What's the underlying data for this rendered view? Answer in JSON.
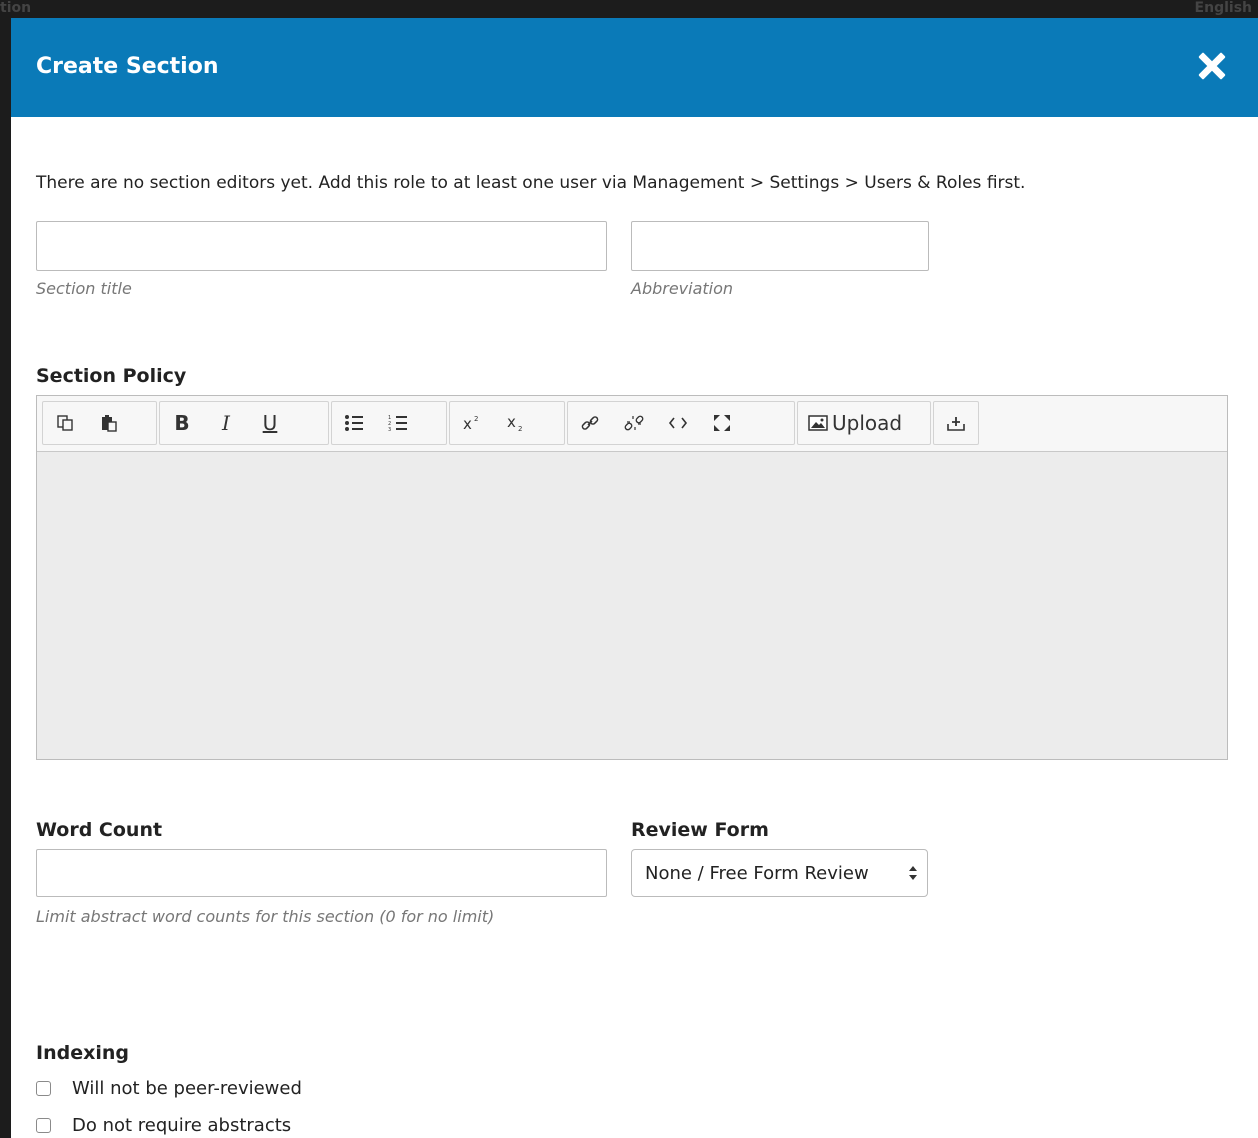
{
  "background": {
    "left_text": "tion",
    "right_text": "English"
  },
  "modal": {
    "title": "Create Section",
    "close_icon": "close-icon",
    "notice": "There are no section editors yet. Add this role to at least one user via Management > Settings > Users & Roles first.",
    "section_title": {
      "value": "",
      "hint": "Section title"
    },
    "abbreviation": {
      "value": "",
      "hint": "Abbreviation"
    },
    "section_policy": {
      "label": "Section Policy",
      "toolbar": {
        "copy": "copy-icon",
        "paste": "paste-icon",
        "bold": "B",
        "italic": "I",
        "underline": "U",
        "bullet_list": "bullet-list-icon",
        "numbered_list": "numbered-list-icon",
        "superscript": "superscript-icon",
        "subscript": "subscript-icon",
        "link": "link-icon",
        "unlink": "unlink-icon",
        "code": "code-icon",
        "fullscreen": "fullscreen-icon",
        "upload_label": "Upload",
        "insert": "insert-icon"
      },
      "content": ""
    },
    "word_count": {
      "label": "Word Count",
      "value": "",
      "hint": "Limit abstract word counts for this section (0 for no limit)"
    },
    "review_form": {
      "label": "Review Form",
      "selected": "None / Free Form Review"
    },
    "indexing": {
      "label": "Indexing",
      "options": [
        {
          "label": "Will not be peer-reviewed",
          "checked": false
        },
        {
          "label": "Do not require abstracts",
          "checked": false
        }
      ]
    }
  },
  "colors": {
    "header": "#0a7ab8",
    "editor_body": "#ececec"
  }
}
